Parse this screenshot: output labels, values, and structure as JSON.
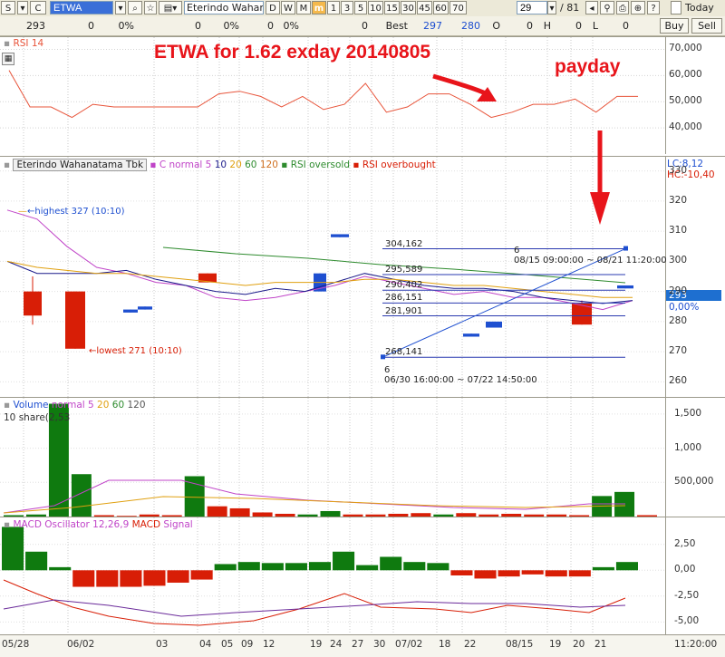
{
  "toolbar": {
    "period_label": "S",
    "market_label": "C",
    "ticker": "ETWA",
    "company_name": "Eterindo Wahan",
    "period_buttons": [
      "D",
      "W",
      "M",
      "m",
      "1",
      "3",
      "5",
      "10",
      "15",
      "30",
      "45",
      "60",
      "70"
    ],
    "active_period": "m",
    "bar_count": "29",
    "page_info": "/ 81",
    "today_label": "Today"
  },
  "quote": {
    "price": "293",
    "change": "0",
    "change_pct": "0%",
    "volume": "0",
    "vol_pct": "0%",
    "value": "0",
    "value_pct": "0%",
    "last": "0",
    "best_label": "Best",
    "best_bid": "297",
    "best_ask": "280",
    "o_label": "O",
    "o_val": "0",
    "h_label": "H",
    "h_val": "0",
    "l_label": "L",
    "l_val": "0",
    "buy_label": "Buy",
    "sell_label": "Sell"
  },
  "annotations": {
    "headline": "ETWA for 1.62 exday 20140805",
    "payday": "payday"
  },
  "rsi_panel": {
    "title": "RSI 14",
    "ticks": [
      "70,000",
      "60,000",
      "50,000",
      "40,000"
    ]
  },
  "price_panel": {
    "legend": {
      "name": "Eterindo Wahanatama Tbk",
      "ma_label": "C normal",
      "ma5": "5",
      "ma10": "10",
      "ma20": "20",
      "ma60": "60",
      "ma120": "120",
      "rsi_oversold": "RSI oversold",
      "rsi_overbought": "RSI overbought"
    },
    "lc": "LC:8,12",
    "hc": "HC:-10,40",
    "highest": "highest 327 (10:10)",
    "lowest": "lowest 271 (10:10)",
    "ticks": [
      "330",
      "320",
      "310",
      "300",
      "290",
      "280",
      "270",
      "260"
    ],
    "current_price": "293",
    "current_pct": "0,00%",
    "levels": [
      "304,162",
      "295,589",
      "290,402",
      "286,151",
      "281,901",
      "268,141"
    ],
    "period_top": "6",
    "period_top_range": "08/15 09:00:00 ~ 08/21 11:20:00",
    "period_bottom": "6",
    "period_bottom_range": "06/30 16:00:00 ~ 07/22 14:50:00"
  },
  "volume_panel": {
    "title": "Volume",
    "ma_label": "normal",
    "ma5": "5",
    "ma20": "20",
    "ma60": "60",
    "ma120": "120",
    "unit": "10 share(2,53",
    "ticks": [
      "1,500",
      "1,000",
      "500,000"
    ]
  },
  "macd_panel": {
    "title": "MACD Oscillator 12,26,9",
    "macd_label": "MACD",
    "signal_label": "Signal",
    "ticks": [
      "2,50",
      "0,00",
      "-2,50",
      "-5,00"
    ]
  },
  "x_axis": {
    "labels": [
      "05/28",
      "06/02",
      "03",
      "04",
      "05",
      "09",
      "12",
      "19",
      "24",
      "27",
      "30",
      "07/02",
      "18",
      "22",
      "08/15",
      "19",
      "20",
      "21"
    ],
    "end_time": "11:20:00"
  },
  "colors": {
    "up": "#d81e06",
    "down": "#0f7a0f",
    "blue": "#1e4fd0",
    "rsi": "#e8543a",
    "ma5": "#c044c8",
    "ma10": "#1a1a8a",
    "ma20": "#e0a010",
    "ma60": "#2e8b2e",
    "ma120": "#d07020",
    "headline": "#e8141a"
  },
  "chart_data": [
    {
      "type": "line",
      "title": "RSI 14",
      "ylim": [
        30000,
        75000
      ],
      "series": [
        {
          "name": "RSI 14",
          "values": [
            62000,
            48000,
            48000,
            44000,
            49000,
            48000,
            48000,
            48000,
            48000,
            48000,
            53000,
            54000,
            52000,
            48000,
            52000,
            47000,
            49000,
            57000,
            46000,
            48000,
            53000,
            53000,
            49000,
            44000,
            46000,
            49000,
            49000,
            51000,
            46000,
            52000,
            52000
          ]
        }
      ]
    },
    {
      "type": "candlestick",
      "title": "Eterindo Wahanatama Tbk",
      "ylim": [
        255,
        335
      ],
      "bars": [
        {
          "open": 290,
          "close": 282,
          "high": 295,
          "low": 279
        },
        {
          "open": 290,
          "close": 271,
          "high": 290,
          "low": 271
        },
        {
          "open": 296,
          "close": 293,
          "high": 296,
          "low": 293
        },
        {
          "open": 283,
          "close": 284,
          "high": 284,
          "low": 283
        },
        {
          "open": 284,
          "close": 285,
          "high": 285,
          "low": 284
        },
        {
          "open": 290,
          "close": 296,
          "high": 296,
          "low": 290
        },
        {
          "open": 308,
          "close": 309,
          "high": 309,
          "low": 308
        },
        {
          "open": 275,
          "close": 276,
          "high": 276,
          "low": 275
        },
        {
          "open": 278,
          "close": 280,
          "high": 280,
          "low": 278
        },
        {
          "open": 286,
          "close": 279,
          "high": 287,
          "low": 279
        },
        {
          "open": 291,
          "close": 292,
          "high": 292,
          "low": 291
        }
      ]
    },
    {
      "type": "bar",
      "title": "Volume",
      "ylim": [
        0,
        1750000
      ],
      "values": [
        20000,
        30000,
        1650000,
        620000,
        20000,
        10000,
        30000,
        20000,
        590000,
        150000,
        120000,
        60000,
        40000,
        30000,
        80000,
        30000,
        30000,
        40000,
        50000,
        30000,
        50000,
        30000,
        40000,
        30000,
        30000,
        20000,
        300000,
        360000,
        20000
      ]
    },
    {
      "type": "bar",
      "title": "MACD Oscillator 12,26,9",
      "ylim": [
        -6.2,
        5.2
      ],
      "values": [
        4.2,
        1.8,
        0.3,
        -1.6,
        -1.6,
        -1.6,
        -1.5,
        -1.2,
        -0.9,
        0.6,
        0.8,
        0.7,
        0.7,
        0.8,
        1.8,
        0.5,
        1.3,
        0.8,
        0.7,
        -0.5,
        -0.8,
        -0.6,
        -0.4,
        -0.6,
        -0.6,
        0.3,
        0.8
      ]
    }
  ]
}
